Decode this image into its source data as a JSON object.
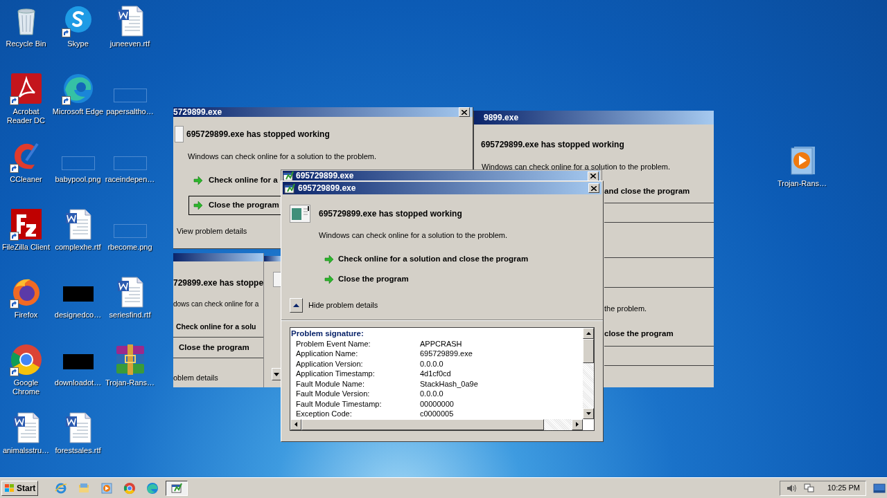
{
  "desktop_icons": [
    {
      "label": "Recycle Bin",
      "kind": "recycle",
      "shortcut": false
    },
    {
      "label": "Skype",
      "kind": "skype",
      "shortcut": true
    },
    {
      "label": "juneeven.rtf",
      "kind": "word",
      "shortcut": false
    },
    {
      "label": "Acrobat Reader DC",
      "kind": "acrobat",
      "shortcut": true
    },
    {
      "label": "Microsoft Edge",
      "kind": "edge",
      "shortcut": true
    },
    {
      "label": "papersaltho…",
      "kind": "image",
      "shortcut": false
    },
    {
      "label": "CCleaner",
      "kind": "ccleaner",
      "shortcut": true
    },
    {
      "label": "babypool.png",
      "kind": "image",
      "shortcut": false
    },
    {
      "label": "raceindepen…",
      "kind": "image",
      "shortcut": false
    },
    {
      "label": "FileZilla Client",
      "kind": "filezilla",
      "shortcut": true
    },
    {
      "label": "complexhe.rtf",
      "kind": "word",
      "shortcut": false
    },
    {
      "label": "rbecome.png",
      "kind": "image",
      "shortcut": false
    },
    {
      "label": "Firefox",
      "kind": "firefox",
      "shortcut": true
    },
    {
      "label": "designedco…",
      "kind": "black",
      "shortcut": false
    },
    {
      "label": "seriesfind.rtf",
      "kind": "word",
      "shortcut": false
    },
    {
      "label": "Google Chrome",
      "kind": "chrome",
      "shortcut": true
    },
    {
      "label": "downloadot…",
      "kind": "black",
      "shortcut": false
    },
    {
      "label": "Trojan-Rans…",
      "kind": "winrar",
      "shortcut": false
    },
    {
      "label": "animalsstru…",
      "kind": "word",
      "shortcut": false
    },
    {
      "label": "forestsales.rtf",
      "kind": "word",
      "shortcut": false
    }
  ],
  "desktop_icon_right": {
    "label": "Trojan-Rans…",
    "kind": "mediaplayer",
    "shortcut": false
  },
  "back_window_left": {
    "title": "5729899.exe",
    "heading": "695729899.exe has stopped working",
    "message": "Windows can check online for a solution to the problem.",
    "options": [
      {
        "label": "Check online for a",
        "focused": false
      },
      {
        "label": "Close the program",
        "focused": true
      }
    ],
    "details": "View problem details"
  },
  "back_window_right": {
    "title": "9899.exe",
    "heading": "695729899.exe has stopped working",
    "message": "Windows can check online for a solution to the problem.",
    "fragment_1": "and close the program",
    "fragment_2": "the problem.",
    "fragment_3": "close the program"
  },
  "back_window_lower_left": {
    "heading": "729899.exe has stoppe",
    "message": "dows can check online for a",
    "options": [
      "Check online for a solu",
      "Close the program"
    ],
    "details": "oblem details"
  },
  "dialog": {
    "behind_title": "695729899.exe",
    "title": "695729899.exe",
    "heading": "695729899.exe has stopped working",
    "message": "Windows can check online for a solution to the problem.",
    "options": [
      "Check online for a solution and close the program",
      "Close the program"
    ],
    "details_toggle": {
      "label": "Hide problem details",
      "expanded": true
    },
    "signature_title": "Problem signature:",
    "signature": [
      {
        "name": "Problem Event Name:",
        "value": "APPCRASH"
      },
      {
        "name": "Application Name:",
        "value": "695729899.exe"
      },
      {
        "name": "Application Version:",
        "value": "0.0.0.0"
      },
      {
        "name": "Application Timestamp:",
        "value": "4d1cf0cd"
      },
      {
        "name": "Fault Module Name:",
        "value": "StackHash_0a9e"
      },
      {
        "name": "Fault Module Version:",
        "value": "0.0.0.0"
      },
      {
        "name": "Fault Module Timestamp:",
        "value": "00000000"
      },
      {
        "name": "Exception Code:",
        "value": "c0000005"
      }
    ]
  },
  "taskbar": {
    "start": "Start",
    "quick_launch": [
      {
        "kind": "ie"
      },
      {
        "kind": "explorer"
      },
      {
        "kind": "media"
      },
      {
        "kind": "chrome"
      },
      {
        "kind": "edge"
      }
    ],
    "tasks": [
      {
        "kind": "error-app",
        "selected": true
      }
    ],
    "clock": "10:25 PM"
  }
}
